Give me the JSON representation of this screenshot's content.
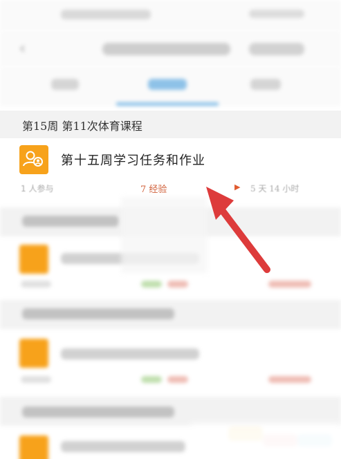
{
  "section": {
    "title": "第15周 第11次体育课程"
  },
  "task": {
    "title": "第十五周学习任务和作业",
    "icon": "group-task-icon",
    "icon_color": "#f7a21b",
    "participants": "1 人参与",
    "experience": "7 经验",
    "remaining": "5 天 14 小时",
    "play_icon": "play-triangle-icon"
  },
  "colors": {
    "accent_blue": "#5fa9e0",
    "annotation_red": "#dd3b3b",
    "section_bg": "#f2f2f2"
  }
}
